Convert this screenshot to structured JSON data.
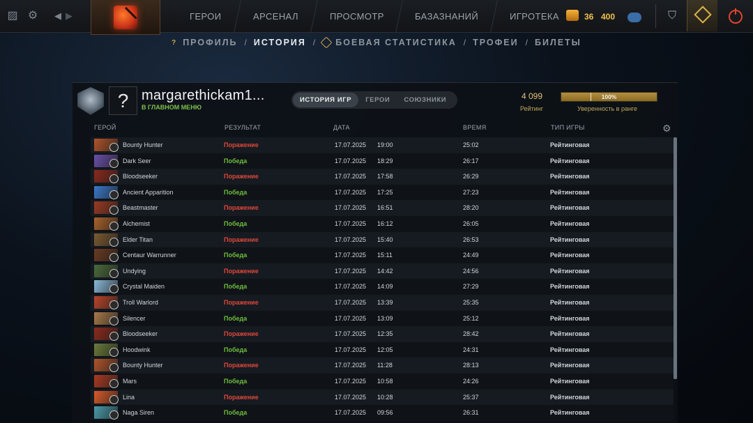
{
  "topbar": {
    "nav": [
      "ГЕРОИ",
      "АРСЕНАЛ",
      "ПРОСМОТР",
      "БАЗАЗНАНИЙ",
      "ИГРОТЕКА"
    ],
    "shards_small": "36",
    "shards_big": "400"
  },
  "subnav": {
    "items": [
      "ПРОФИЛЬ",
      "ИСТОРИЯ",
      "БОЕВАЯ СТАТИСТИКА",
      "ТРОФЕИ",
      "БИЛЕТЫ"
    ],
    "active": "ИСТОРИЯ",
    "separator": "/"
  },
  "profile": {
    "avatar_glyph": "?",
    "username": "margarethickam1...",
    "status": "В ГЛАВНОМ МЕНЮ",
    "tabs": [
      "ИСТОРИЯ ИГР",
      "ГЕРОИ",
      "СОЮЗНИКИ"
    ],
    "active_tab": "ИСТОРИЯ ИГР",
    "rating_value": "4 099",
    "rating_label": "Рейтинг",
    "confidence_value": "100%",
    "confidence_fraction": 1.0,
    "confidence_label": "Уверенность в ранге"
  },
  "table": {
    "headers": [
      "ГЕРОЙ",
      "РЕЗУЛЬТАТ",
      "ДАТА",
      "ВРЕМЯ",
      "ТИП ИГРЫ"
    ],
    "rows": [
      {
        "hero": "Bounty Hunter",
        "result": "Поражение",
        "date": "17.07.2025",
        "time": "19:00",
        "duration": "25:02",
        "type": "Рейтинговая",
        "color": "#b0542a"
      },
      {
        "hero": "Dark Seer",
        "result": "Победа",
        "date": "17.07.2025",
        "time": "18:29",
        "duration": "26:17",
        "type": "Рейтинговая",
        "color": "#6a4fa8"
      },
      {
        "hero": "Bloodseeker",
        "result": "Поражение",
        "date": "17.07.2025",
        "time": "17:58",
        "duration": "26:29",
        "type": "Рейтинговая",
        "color": "#8a2a1c"
      },
      {
        "hero": "Ancient Apparition",
        "result": "Победа",
        "date": "17.07.2025",
        "time": "17:25",
        "duration": "27:23",
        "type": "Рейтинговая",
        "color": "#3a78c8"
      },
      {
        "hero": "Beastmaster",
        "result": "Поражение",
        "date": "17.07.2025",
        "time": "16:51",
        "duration": "28:20",
        "type": "Рейтинговая",
        "color": "#9a3a22"
      },
      {
        "hero": "Alchemist",
        "result": "Победа",
        "date": "17.07.2025",
        "time": "16:12",
        "duration": "26:05",
        "type": "Рейтинговая",
        "color": "#a8622a"
      },
      {
        "hero": "Elder Titan",
        "result": "Поражение",
        "date": "17.07.2025",
        "time": "15:40",
        "duration": "26:53",
        "type": "Рейтинговая",
        "color": "#7a5a30"
      },
      {
        "hero": "Centaur Warrunner",
        "result": "Победа",
        "date": "17.07.2025",
        "time": "15:11",
        "duration": "24:49",
        "type": "Рейтинговая",
        "color": "#6a3a22"
      },
      {
        "hero": "Undying",
        "result": "Поражение",
        "date": "17.07.2025",
        "time": "14:42",
        "duration": "24:56",
        "type": "Рейтинговая",
        "color": "#4a6a3a"
      },
      {
        "hero": "Crystal Maiden",
        "result": "Победа",
        "date": "17.07.2025",
        "time": "14:09",
        "duration": "27:29",
        "type": "Рейтинговая",
        "color": "#8ab8d8"
      },
      {
        "hero": "Troll Warlord",
        "result": "Поражение",
        "date": "17.07.2025",
        "time": "13:39",
        "duration": "25:35",
        "type": "Рейтинговая",
        "color": "#b8442a"
      },
      {
        "hero": "Silencer",
        "result": "Победа",
        "date": "17.07.2025",
        "time": "13:09",
        "duration": "25:12",
        "type": "Рейтинговая",
        "color": "#a87a4a"
      },
      {
        "hero": "Bloodseeker",
        "result": "Поражение",
        "date": "17.07.2025",
        "time": "12:35",
        "duration": "28:42",
        "type": "Рейтинговая",
        "color": "#8a2a1c"
      },
      {
        "hero": "Hoodwink",
        "result": "Победа",
        "date": "17.07.2025",
        "time": "12:05",
        "duration": "24:31",
        "type": "Рейтинговая",
        "color": "#6a7a3a"
      },
      {
        "hero": "Bounty Hunter",
        "result": "Поражение",
        "date": "17.07.2025",
        "time": "11:28",
        "duration": "28:13",
        "type": "Рейтинговая",
        "color": "#b0542a"
      },
      {
        "hero": "Mars",
        "result": "Победа",
        "date": "17.07.2025",
        "time": "10:58",
        "duration": "24:26",
        "type": "Рейтинговая",
        "color": "#a83a22"
      },
      {
        "hero": "Lina",
        "result": "Поражение",
        "date": "17.07.2025",
        "time": "10:28",
        "duration": "25:37",
        "type": "Рейтинговая",
        "color": "#d85a2a"
      },
      {
        "hero": "Naga Siren",
        "result": "Победа",
        "date": "17.07.2025",
        "time": "09:56",
        "duration": "26:31",
        "type": "Рейтинговая",
        "color": "#4a9aa8"
      }
    ]
  }
}
